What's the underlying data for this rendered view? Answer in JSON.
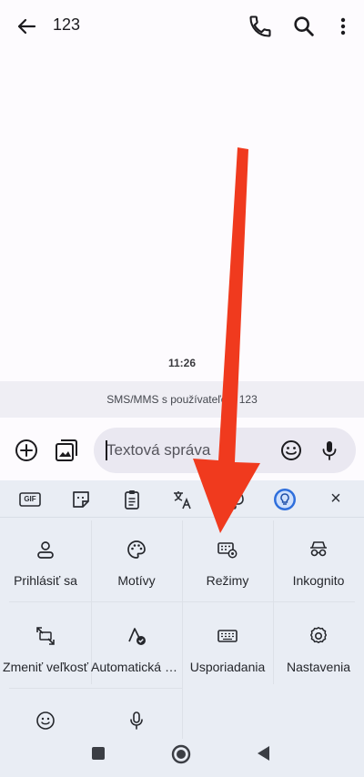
{
  "header": {
    "title": "123"
  },
  "conversation": {
    "time": "11:26",
    "info": "SMS/MMS s používateľom 123"
  },
  "compose": {
    "placeholder": "Textová správa"
  },
  "keyboard": {
    "toolbar": {
      "gif_label": "GIF",
      "close_label": "×"
    },
    "tiles": [
      {
        "label": "Prihlásiť sa",
        "icon": "account-icon"
      },
      {
        "label": "Motívy",
        "icon": "palette-icon"
      },
      {
        "label": "Režimy",
        "icon": "keyboard-settings-icon"
      },
      {
        "label": "Inkognito",
        "icon": "incognito-icon"
      },
      {
        "label": "Zmeniť veľkosť",
        "icon": "resize-icon"
      },
      {
        "label": "Automatická oprava",
        "icon": "autocorrect-icon"
      },
      {
        "label": "Usporiadania",
        "icon": "keyboard-icon"
      },
      {
        "label": "Nastavenia",
        "icon": "gear-icon"
      },
      {
        "label": "",
        "icon": "emoji-icon"
      },
      {
        "label": "",
        "icon": "mic-icon"
      }
    ]
  },
  "annotation": {
    "arrow_color": "#f03a1e"
  }
}
